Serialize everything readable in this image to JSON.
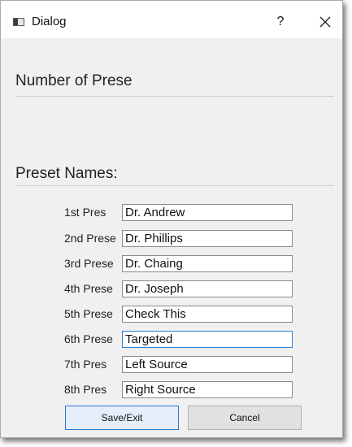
{
  "window": {
    "title": "Dialog",
    "help_label": "?",
    "icons": {
      "app": "dialog-window-icon",
      "close": "close-icon"
    }
  },
  "sections": {
    "number_label": "Number of Prese",
    "names_label": "Preset Names:"
  },
  "presets": [
    {
      "label": "1st Pres",
      "value": "Dr. Andrew"
    },
    {
      "label": "2nd Prese",
      "value": "Dr. Phillips"
    },
    {
      "label": "3rd Prese",
      "value": "Dr. Chaing"
    },
    {
      "label": "4th Prese",
      "value": "Dr. Joseph"
    },
    {
      "label": "5th Prese",
      "value": "Check This"
    },
    {
      "label": "6th Prese",
      "value": "Targeted"
    },
    {
      "label": "7th Pres",
      "value": "Left Source"
    },
    {
      "label": "8th Pres",
      "value": "Right Source"
    }
  ],
  "buttons": {
    "save_exit": "Save/Exit",
    "cancel": "Cancel"
  },
  "colors": {
    "focus_border": "#2f7bd6",
    "primary_button_border": "#2b78d3",
    "window_background": "#f0f0f0"
  }
}
